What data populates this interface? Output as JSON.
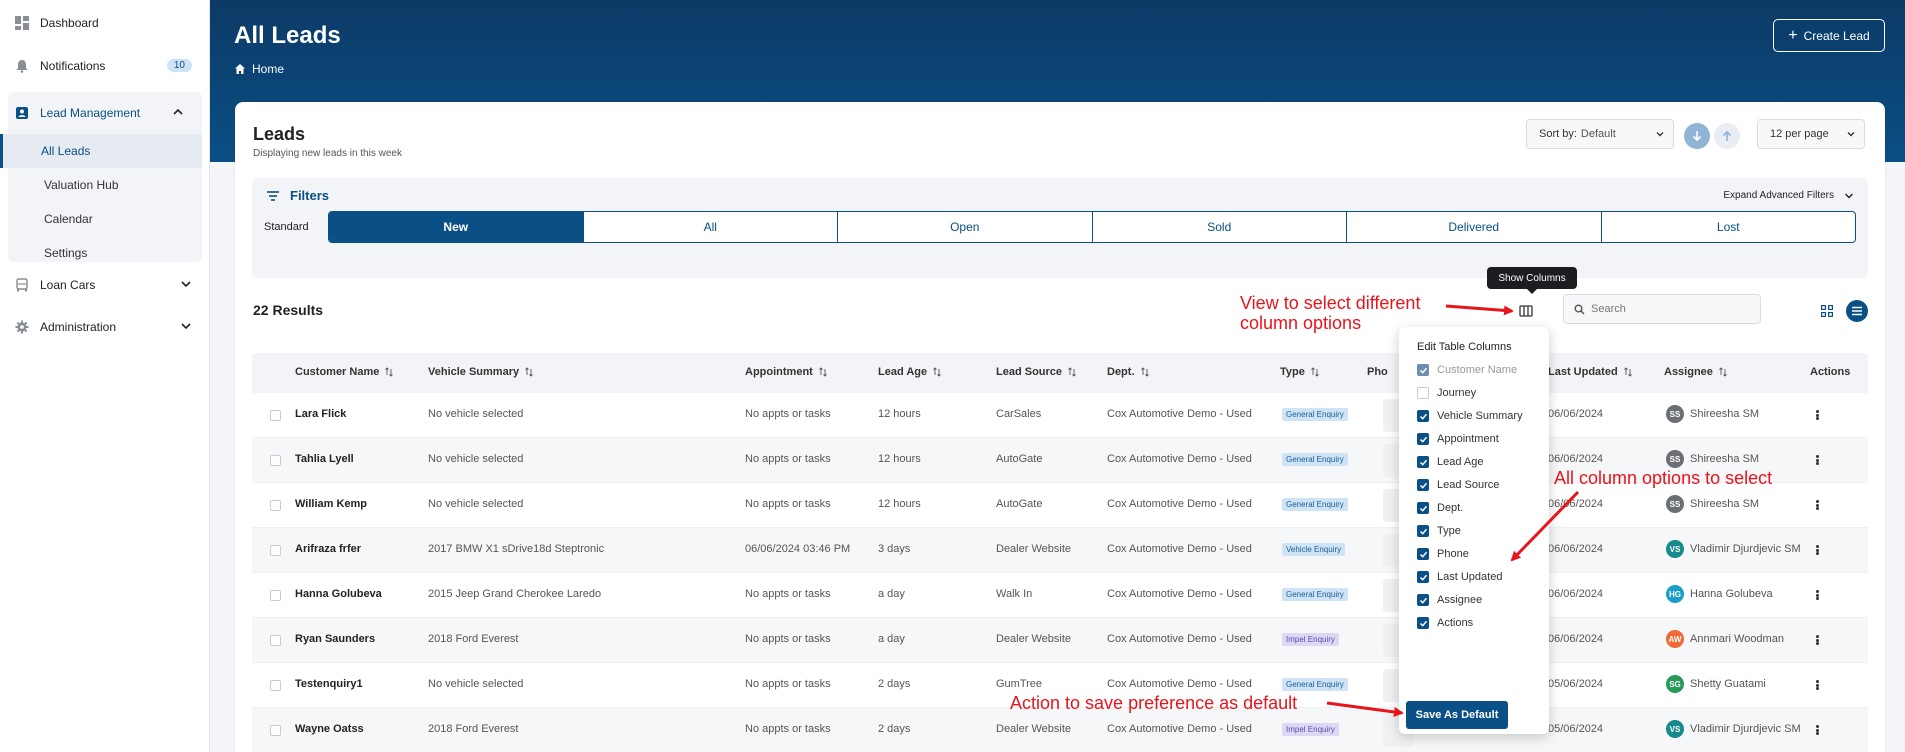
{
  "sidebar": {
    "items": [
      {
        "label": "Dashboard",
        "icon": "dashboard-icon"
      },
      {
        "label": "Notifications",
        "icon": "bell-icon",
        "badge": "10"
      },
      {
        "label": "Lead Management",
        "icon": "contact-icon"
      },
      {
        "label": "Loan Cars",
        "icon": "car-icon"
      },
      {
        "label": "Administration",
        "icon": "gear-icon"
      }
    ],
    "sub_items": [
      "All Leads",
      "Valuation Hub",
      "Calendar",
      "Settings"
    ],
    "active_sub": "All Leads"
  },
  "header": {
    "title": "All Leads",
    "breadcrumb": "Home",
    "create_label": "Create Lead"
  },
  "card": {
    "title": "Leads",
    "subtitle": "Displaying new leads in this week",
    "sort_label": "Sort by:",
    "sort_value": "Default",
    "per_page": "12 per page"
  },
  "filters": {
    "title": "Filters",
    "expand_label": "Expand Advanced Filters",
    "standard_label": "Standard",
    "tabs": [
      "New",
      "All",
      "Open",
      "Sold",
      "Delivered",
      "Lost"
    ],
    "active_tab": "New"
  },
  "toolbar": {
    "results": "22 Results",
    "tooltip": "Show Columns",
    "search_placeholder": "Search"
  },
  "table": {
    "headers": [
      "Customer Name",
      "Vehicle Summary",
      "Appointment",
      "Lead Age",
      "Lead Source",
      "Dept.",
      "Type",
      "Pho",
      "Last Updated",
      "Assignee",
      "Actions"
    ],
    "rows": [
      {
        "name": "Lara Flick",
        "vehicle": "No vehicle selected",
        "appt": "No appts or tasks",
        "age": "12 hours",
        "source": "CarSales",
        "dept": "Cox Automotive Demo - Used",
        "type": "General Enquiry",
        "updated": "06/06/2024",
        "initials": "SS",
        "assignee": "Shireesha SM",
        "color": "#6b6f75"
      },
      {
        "name": "Tahlia Lyell",
        "vehicle": "No vehicle selected",
        "appt": "No appts or tasks",
        "age": "12 hours",
        "source": "AutoGate",
        "dept": "Cox Automotive Demo - Used",
        "type": "General Enquiry",
        "updated": "06/06/2024",
        "initials": "SS",
        "assignee": "Shireesha SM",
        "color": "#6b6f75"
      },
      {
        "name": "William Kemp",
        "vehicle": "No vehicle selected",
        "appt": "No appts or tasks",
        "age": "12 hours",
        "source": "AutoGate",
        "dept": "Cox Automotive Demo - Used",
        "type": "General Enquiry",
        "updated": "06/06/2024",
        "initials": "SS",
        "assignee": "Shireesha SM",
        "color": "#6b6f75"
      },
      {
        "name": "Arifraza frfer",
        "vehicle": "2017 BMW X1 sDrive18d Steptronic",
        "appt": "06/06/2024 03:46 PM",
        "age": "3 days",
        "source": "Dealer Website",
        "dept": "Cox Automotive Demo - Used",
        "type": "Vehicle Enquiry",
        "updated": "06/06/2024",
        "initials": "VS",
        "assignee": "Vladimir Djurdjevic SM",
        "color": "#178a8e"
      },
      {
        "name": "Hanna Golubeva",
        "vehicle": "2015 Jeep Grand Cherokee Laredo",
        "appt": "No appts or tasks",
        "age": "a day",
        "source": "Walk In",
        "dept": "Cox Automotive Demo - Used",
        "type": "General Enquiry",
        "updated": "06/06/2024",
        "initials": "HG",
        "assignee": "Hanna Golubeva",
        "color": "#1aa0c8"
      },
      {
        "name": "Ryan Saunders",
        "vehicle": "2018 Ford Everest",
        "appt": "No appts or tasks",
        "age": "a day",
        "source": "Dealer Website",
        "dept": "Cox Automotive Demo - Used",
        "type": "Impel Enquiry",
        "updated": "06/06/2024",
        "initials": "AW",
        "assignee": "Annmari Woodman",
        "color": "#f06a35"
      },
      {
        "name": "Testenquiry1",
        "vehicle": "No vehicle selected",
        "appt": "No appts or tasks",
        "age": "2 days",
        "source": "GumTree",
        "dept": "Cox Automotive Demo - Used",
        "type": "General Enquiry",
        "updated": "05/06/2024",
        "initials": "SG",
        "assignee": "Shetty Guatami",
        "color": "#2a9a5a"
      },
      {
        "name": "Wayne Oatss",
        "vehicle": "2018 Ford Everest",
        "appt": "No appts or tasks",
        "age": "2 days",
        "source": "Dealer Website",
        "dept": "Cox Automotive Demo - Used",
        "type": "Impel Enquiry",
        "updated": "05/06/2024",
        "initials": "VS",
        "assignee": "Vladimir Djurdjevic SM",
        "color": "#178a8e"
      }
    ]
  },
  "columns_popup": {
    "title": "Edit Table Columns",
    "options": [
      {
        "label": "Customer Name",
        "checked": true,
        "disabled": true
      },
      {
        "label": "Journey",
        "checked": false
      },
      {
        "label": "Vehicle Summary",
        "checked": true
      },
      {
        "label": "Appointment",
        "checked": true
      },
      {
        "label": "Lead Age",
        "checked": true
      },
      {
        "label": "Lead Source",
        "checked": true
      },
      {
        "label": "Dept.",
        "checked": true
      },
      {
        "label": "Type",
        "checked": true
      },
      {
        "label": "Phone",
        "checked": true
      },
      {
        "label": "Last Updated",
        "checked": true
      },
      {
        "label": "Assignee",
        "checked": true
      },
      {
        "label": "Actions",
        "checked": true
      }
    ],
    "save_label": "Save As Default"
  },
  "annotations": {
    "view_columns": "View to select different\ncolumn options",
    "all_options": "All column options to select",
    "save_default": "Action to save preference as default",
    "color": "#e8141b"
  },
  "colors": {
    "brand": "#0a4f85",
    "header_dark": "#0c3a66"
  }
}
